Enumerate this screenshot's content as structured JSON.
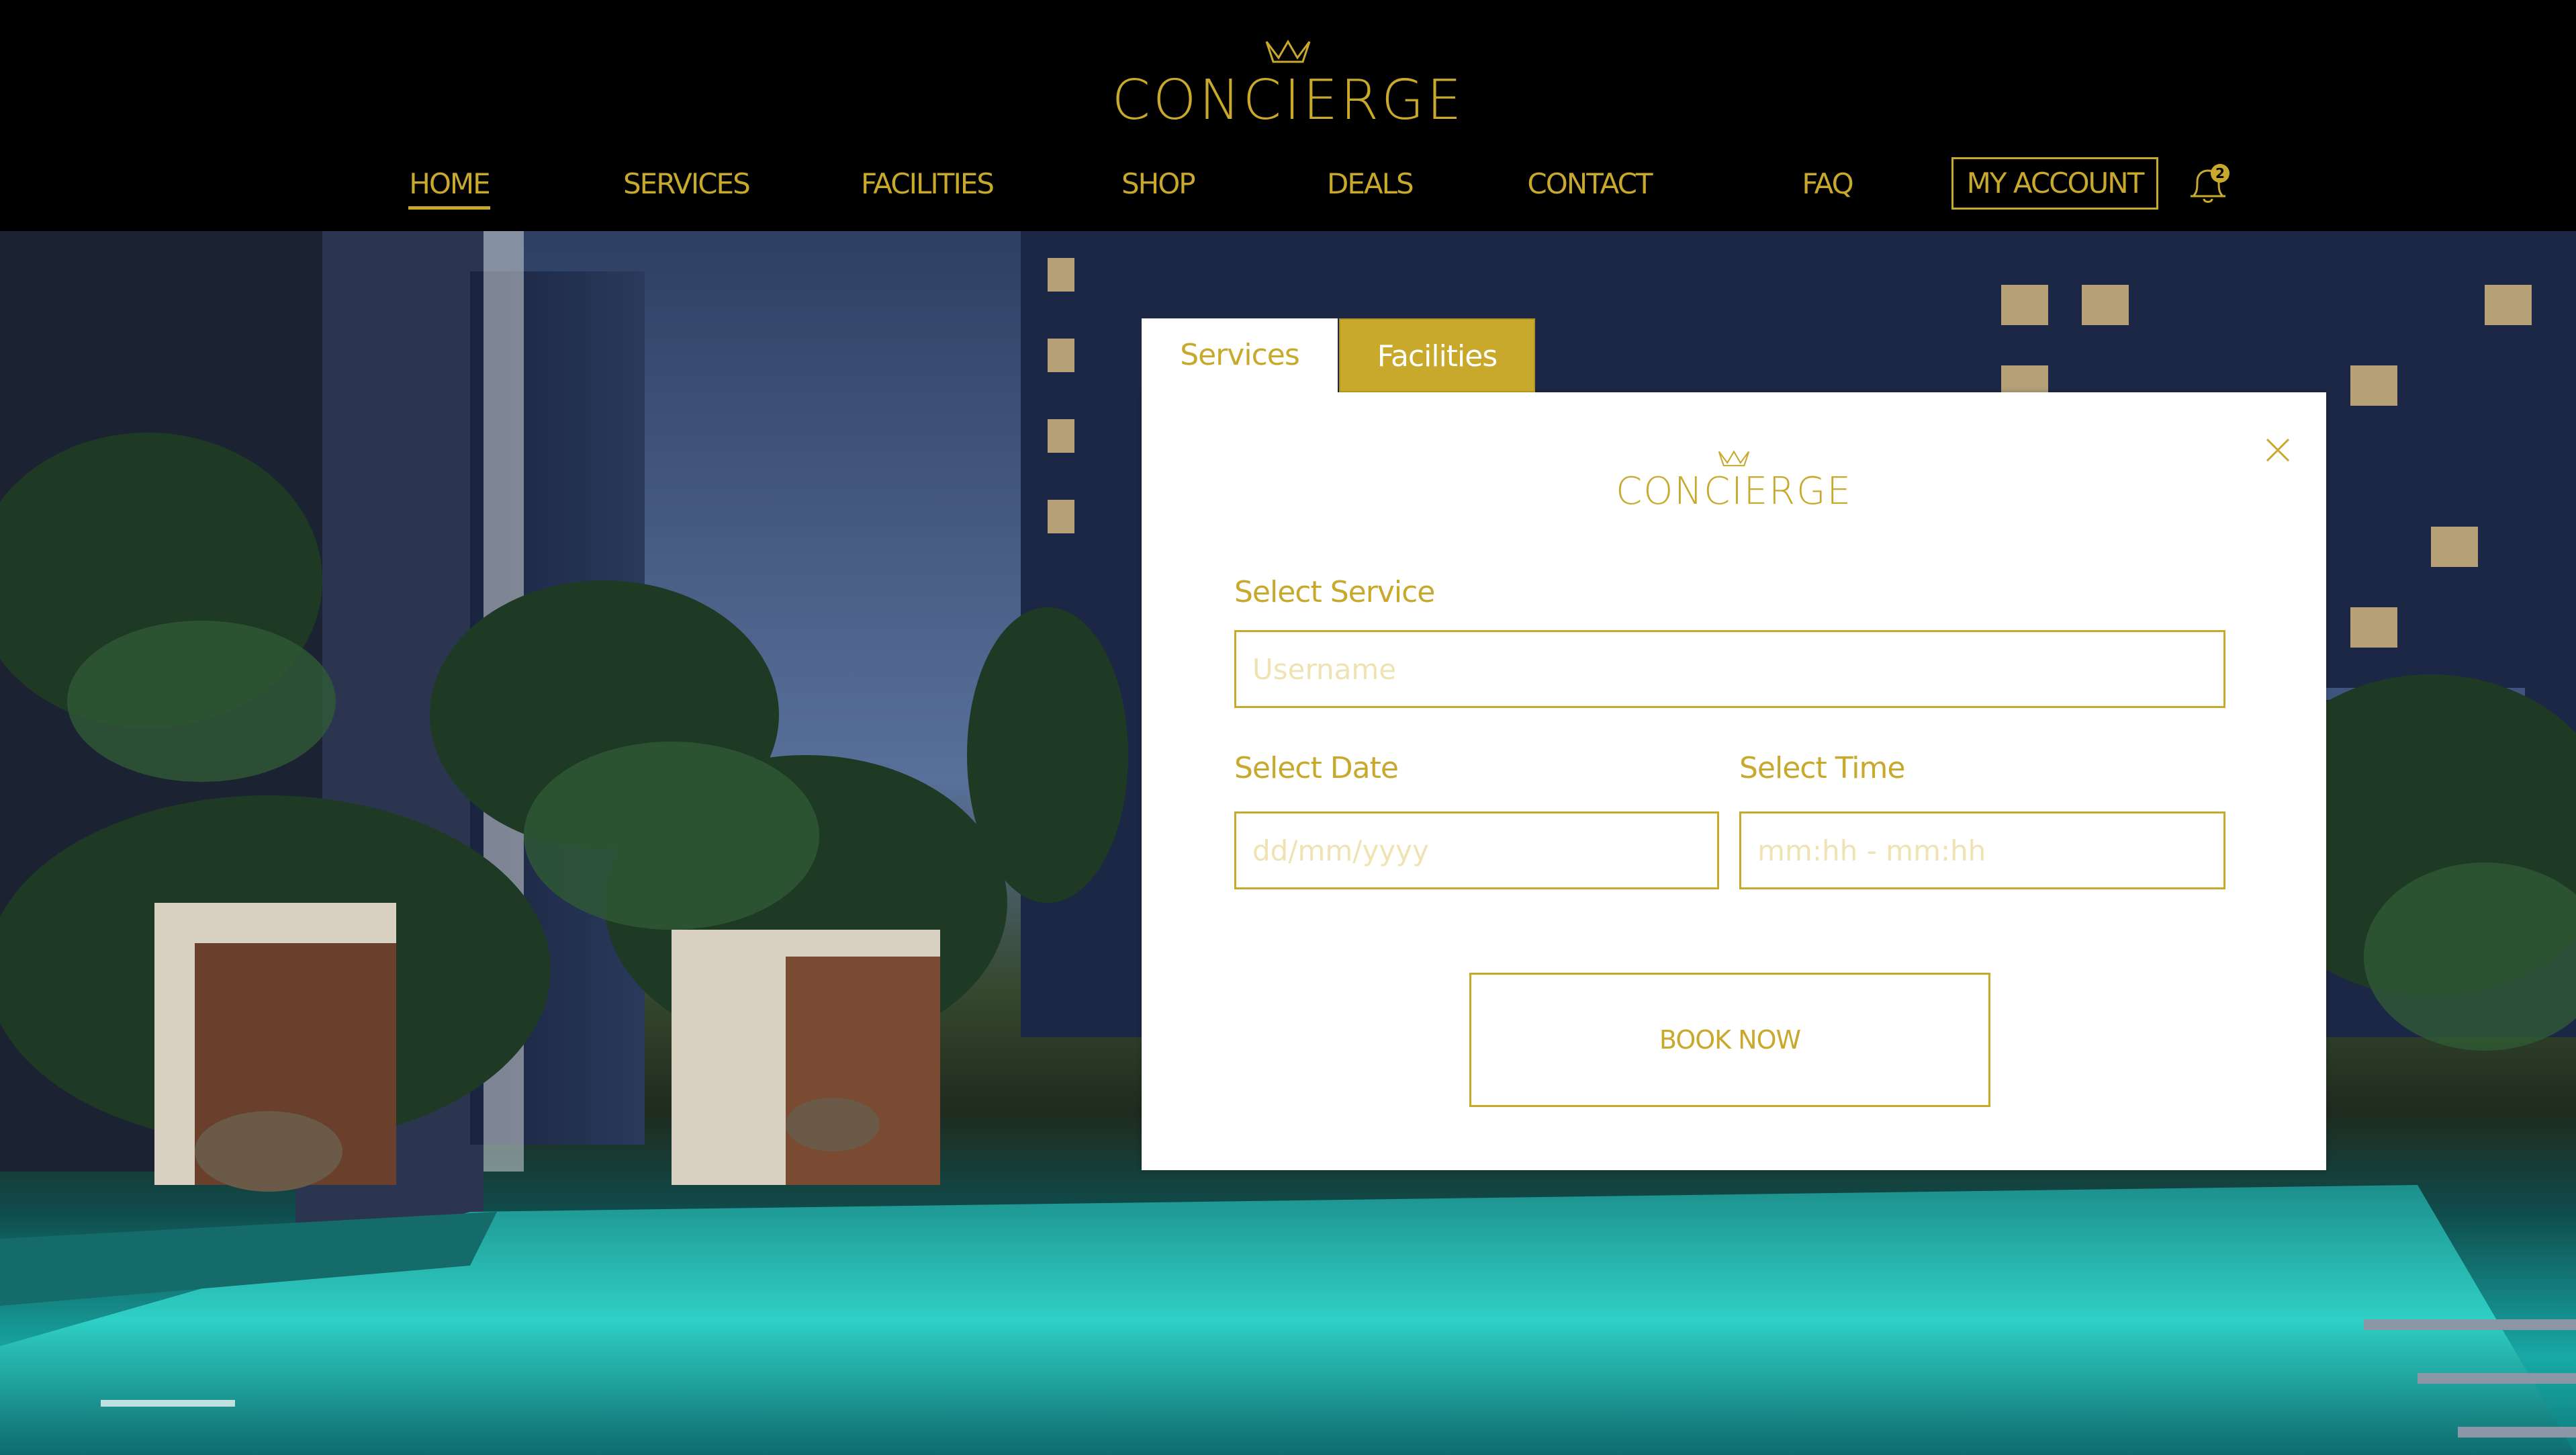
{
  "brand": {
    "name": "CONCIERGE",
    "logo_icon": "crown-icon",
    "accent_color": "#c8a92c"
  },
  "nav": {
    "items": [
      {
        "label": "HOME",
        "active": true
      },
      {
        "label": "SERVICES",
        "active": false
      },
      {
        "label": "FACILITIES",
        "active": false
      },
      {
        "label": "SHOP",
        "active": false
      },
      {
        "label": "DEALS",
        "active": false
      },
      {
        "label": "CONTACT",
        "active": false
      },
      {
        "label": "FAQ",
        "active": false
      }
    ],
    "account_label": "MY ACCOUNT",
    "notification_icon": "bell-icon",
    "notification_count": "2"
  },
  "modal": {
    "tabs": [
      {
        "label": "Services",
        "active": true
      },
      {
        "label": "Facilities",
        "active": false
      }
    ],
    "close_icon": "close-icon",
    "brand": "CONCIERGE",
    "service": {
      "label": "Select Service",
      "placeholder": "Username"
    },
    "date": {
      "label": "Select Date",
      "placeholder": "dd/mm/yyyy"
    },
    "time": {
      "label": "Select Time",
      "placeholder": "mm:hh - mm:hh"
    },
    "submit_label": "BOOK NOW"
  }
}
